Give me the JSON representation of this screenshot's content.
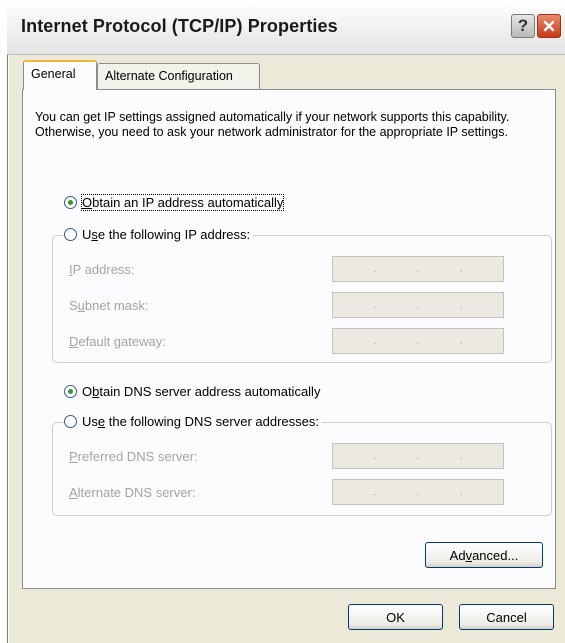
{
  "window": {
    "title": "Internet Protocol (TCP/IP) Properties",
    "help_label": "?",
    "icons": {
      "help": "help-icon",
      "close": "close-icon"
    }
  },
  "tabs": [
    {
      "label": "General",
      "active": true
    },
    {
      "label": "Alternate Configuration",
      "active": false
    }
  ],
  "intro_text": "You can get IP settings assigned automatically if your network supports this capability. Otherwise, you need to ask your network administrator for the appropriate IP settings.",
  "ip": {
    "auto": {
      "pre": "",
      "key": "O",
      "post": "btain an IP address automatically",
      "selected": true
    },
    "manual": {
      "pre": "U",
      "key": "s",
      "post": "e the following IP address:",
      "selected": false
    },
    "fields": [
      {
        "pre": "",
        "key": "I",
        "post": "P address:",
        "dots": [
          ".",
          ".",
          "."
        ]
      },
      {
        "pre": "S",
        "key": "u",
        "post": "bnet mask:",
        "dots": [
          ".",
          ".",
          "."
        ]
      },
      {
        "pre": "",
        "key": "D",
        "post": "efault gateway:",
        "dots": [
          ".",
          ".",
          "."
        ]
      }
    ]
  },
  "dns": {
    "auto": {
      "pre": "O",
      "key": "b",
      "post": "tain DNS server address automatically",
      "selected": true
    },
    "manual": {
      "pre": "Us",
      "key": "e",
      "post": " the following DNS server addresses:",
      "selected": false
    },
    "fields": [
      {
        "pre": "",
        "key": "P",
        "post": "referred DNS server:",
        "dots": [
          ".",
          ".",
          "."
        ]
      },
      {
        "pre": "",
        "key": "A",
        "post": "lternate DNS server:",
        "dots": [
          ".",
          ".",
          "."
        ]
      }
    ]
  },
  "buttons": {
    "advanced": {
      "pre": "Ad",
      "key": "v",
      "post": "anced..."
    },
    "ok": "OK",
    "cancel": "Cancel"
  },
  "colors": {
    "radio_selected": "#2d9a2d",
    "tab_highlight": "#f0b53a",
    "disabled_text": "#a6a59b"
  }
}
